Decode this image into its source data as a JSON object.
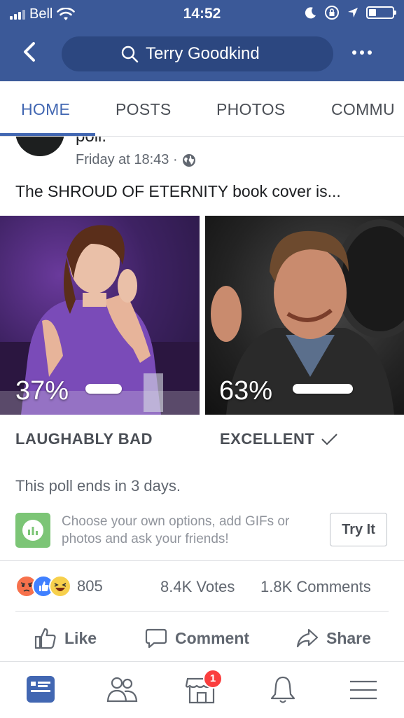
{
  "status_bar": {
    "carrier": "Bell",
    "time": "14:52"
  },
  "nav": {
    "search_text": "Terry Goodkind"
  },
  "tabs": [
    {
      "label": "HOME"
    },
    {
      "label": "POSTS"
    },
    {
      "label": "PHOTOS"
    },
    {
      "label": "COMMU"
    }
  ],
  "post": {
    "header_fragment": "poll.",
    "timestamp": "Friday at 18:43 ·",
    "text": "The SHROUD OF ETERNITY book cover is...",
    "options": [
      {
        "percent": "37%",
        "fraction": 0.37,
        "label": "LAUGHABLY BAD"
      },
      {
        "percent": "63%",
        "fraction": 0.63,
        "label": "EXCELLENT"
      }
    ],
    "ends_text": "This poll ends in 3 days.",
    "promo_text": "Choose your own options, add GIFs or photos and ask your friends!",
    "try_label": "Try It",
    "reaction_count": "805",
    "votes": "8.4K Votes",
    "comments": "1.8K Comments",
    "actions": {
      "like": "Like",
      "comment": "Comment",
      "share": "Share"
    }
  },
  "bottom_nav": {
    "marketplace_badge": "1"
  },
  "colors": {
    "brand": "#3b5998",
    "accent": "#4267b2",
    "badge": "#fa3e3e",
    "angry": "#f7714c",
    "like": "#4080ff",
    "haha": "#f7d04c"
  }
}
